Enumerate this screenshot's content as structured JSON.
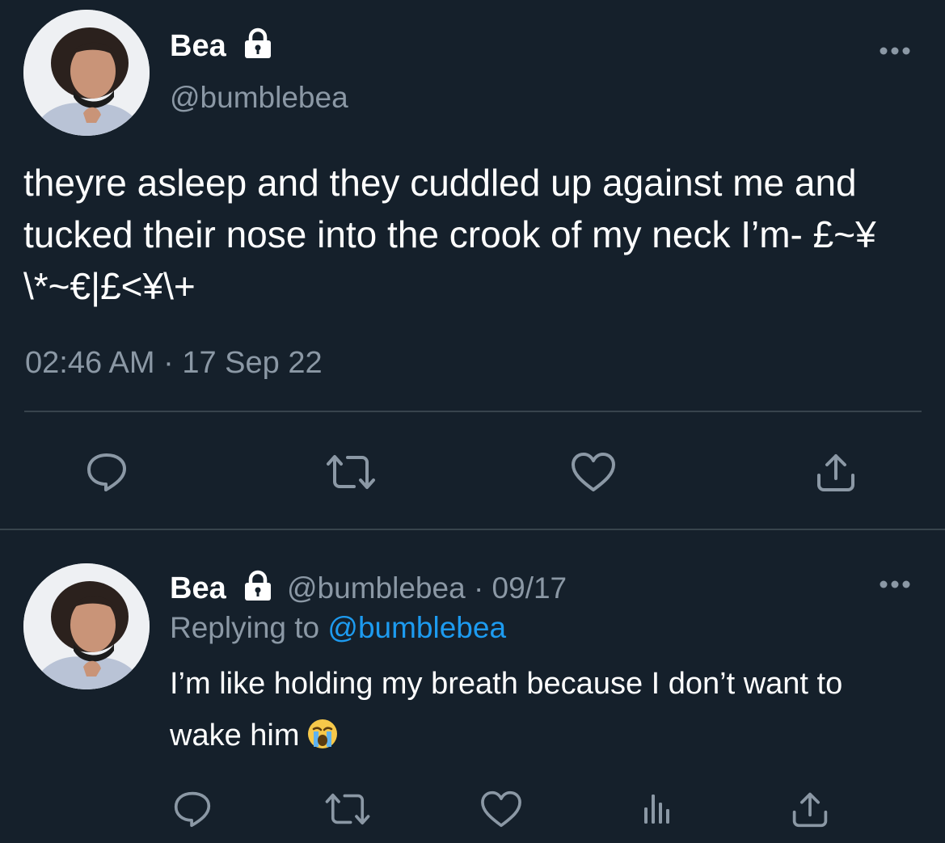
{
  "main_tweet": {
    "display_name": "Bea",
    "handle": "@bumblebea",
    "text": "theyre asleep and they cuddled up against me and tucked their nose into the crook of my neck I’m- £~¥\\*~€|£<¥\\+",
    "time": "02:46 AM",
    "separator": "·",
    "date": "17 Sep 22"
  },
  "reply_tweet": {
    "display_name": "Bea",
    "handle": "@bumblebea",
    "separator": "·",
    "date": "09/17",
    "replying_to_prefix": "Replying to",
    "replying_to_handle": "@bumblebea",
    "text": "I’m like holding my breath because I don’t want to wake him"
  },
  "icons": {
    "lock": "lock-icon",
    "more": "more-options-icon",
    "reply": "reply-icon",
    "retweet": "retweet-icon",
    "like": "heart-icon",
    "share": "share-icon",
    "analytics": "analytics-icon",
    "emoji": "loudly-crying-face-emoji"
  },
  "colors": {
    "background": "#15202b",
    "text": "#ffffff",
    "secondary": "#8b98a5",
    "link": "#1d9bf0",
    "divider": "#38444d"
  }
}
